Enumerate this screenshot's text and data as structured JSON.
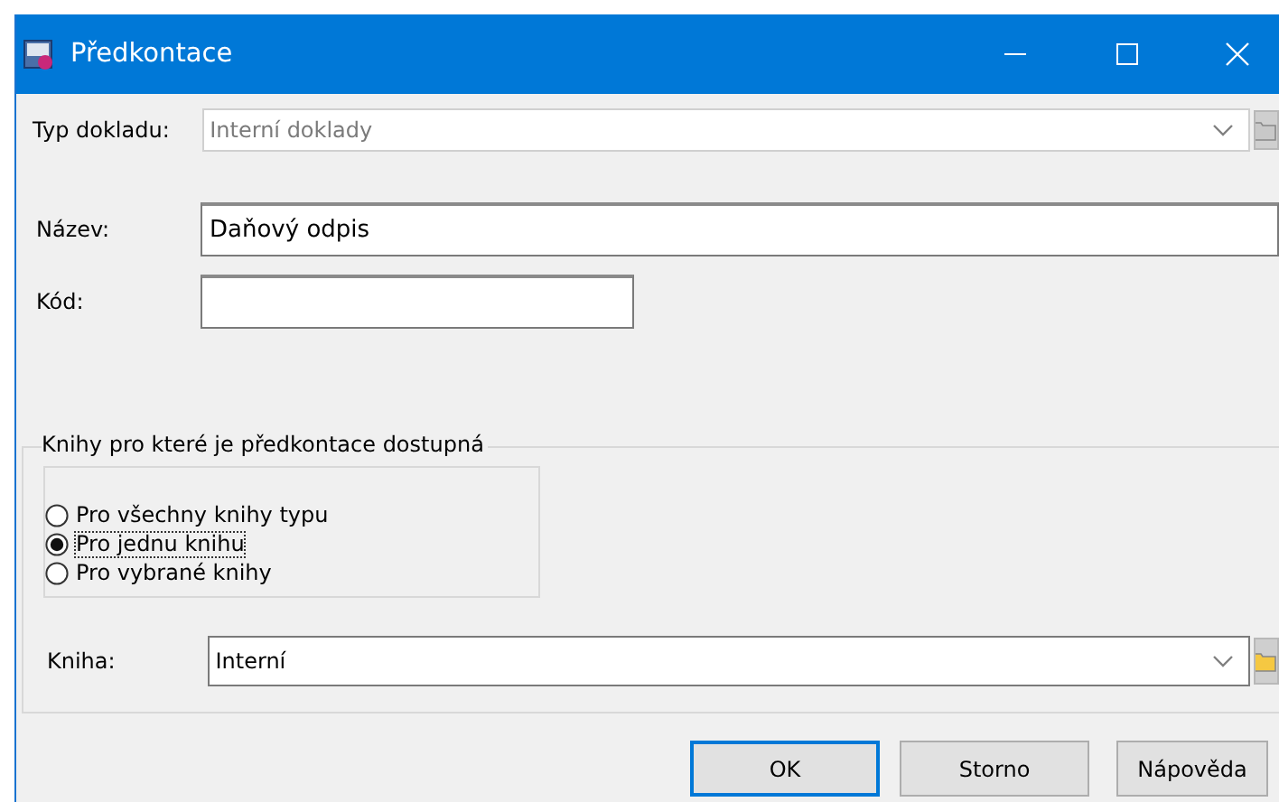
{
  "window": {
    "title": "Předkontace"
  },
  "document_type": {
    "label": "Typ dokladu:",
    "value": "Interní doklady",
    "disabled": true
  },
  "fields": [
    {
      "label": "Název:",
      "value": "Daňový odpis",
      "wide": true
    },
    {
      "label": "Kód:",
      "wide": false
    }
  ],
  "books_group": {
    "title": "Knihy pro které je předkontace dostupná",
    "options": [
      {
        "label": "Pro všechny knihy typu",
        "selected": false
      },
      {
        "label": "Pro jednu knihu",
        "selected": true
      },
      {
        "label": "Pro vybrané knihy",
        "selected": false
      }
    ],
    "book": {
      "label": "Kniha:",
      "value": "Interní",
      "disabled": false
    }
  },
  "buttons": [
    {
      "label": "OK",
      "default": true
    },
    {
      "label": "Storno",
      "default": false
    },
    {
      "label": "Nápověda",
      "default": false
    }
  ]
}
